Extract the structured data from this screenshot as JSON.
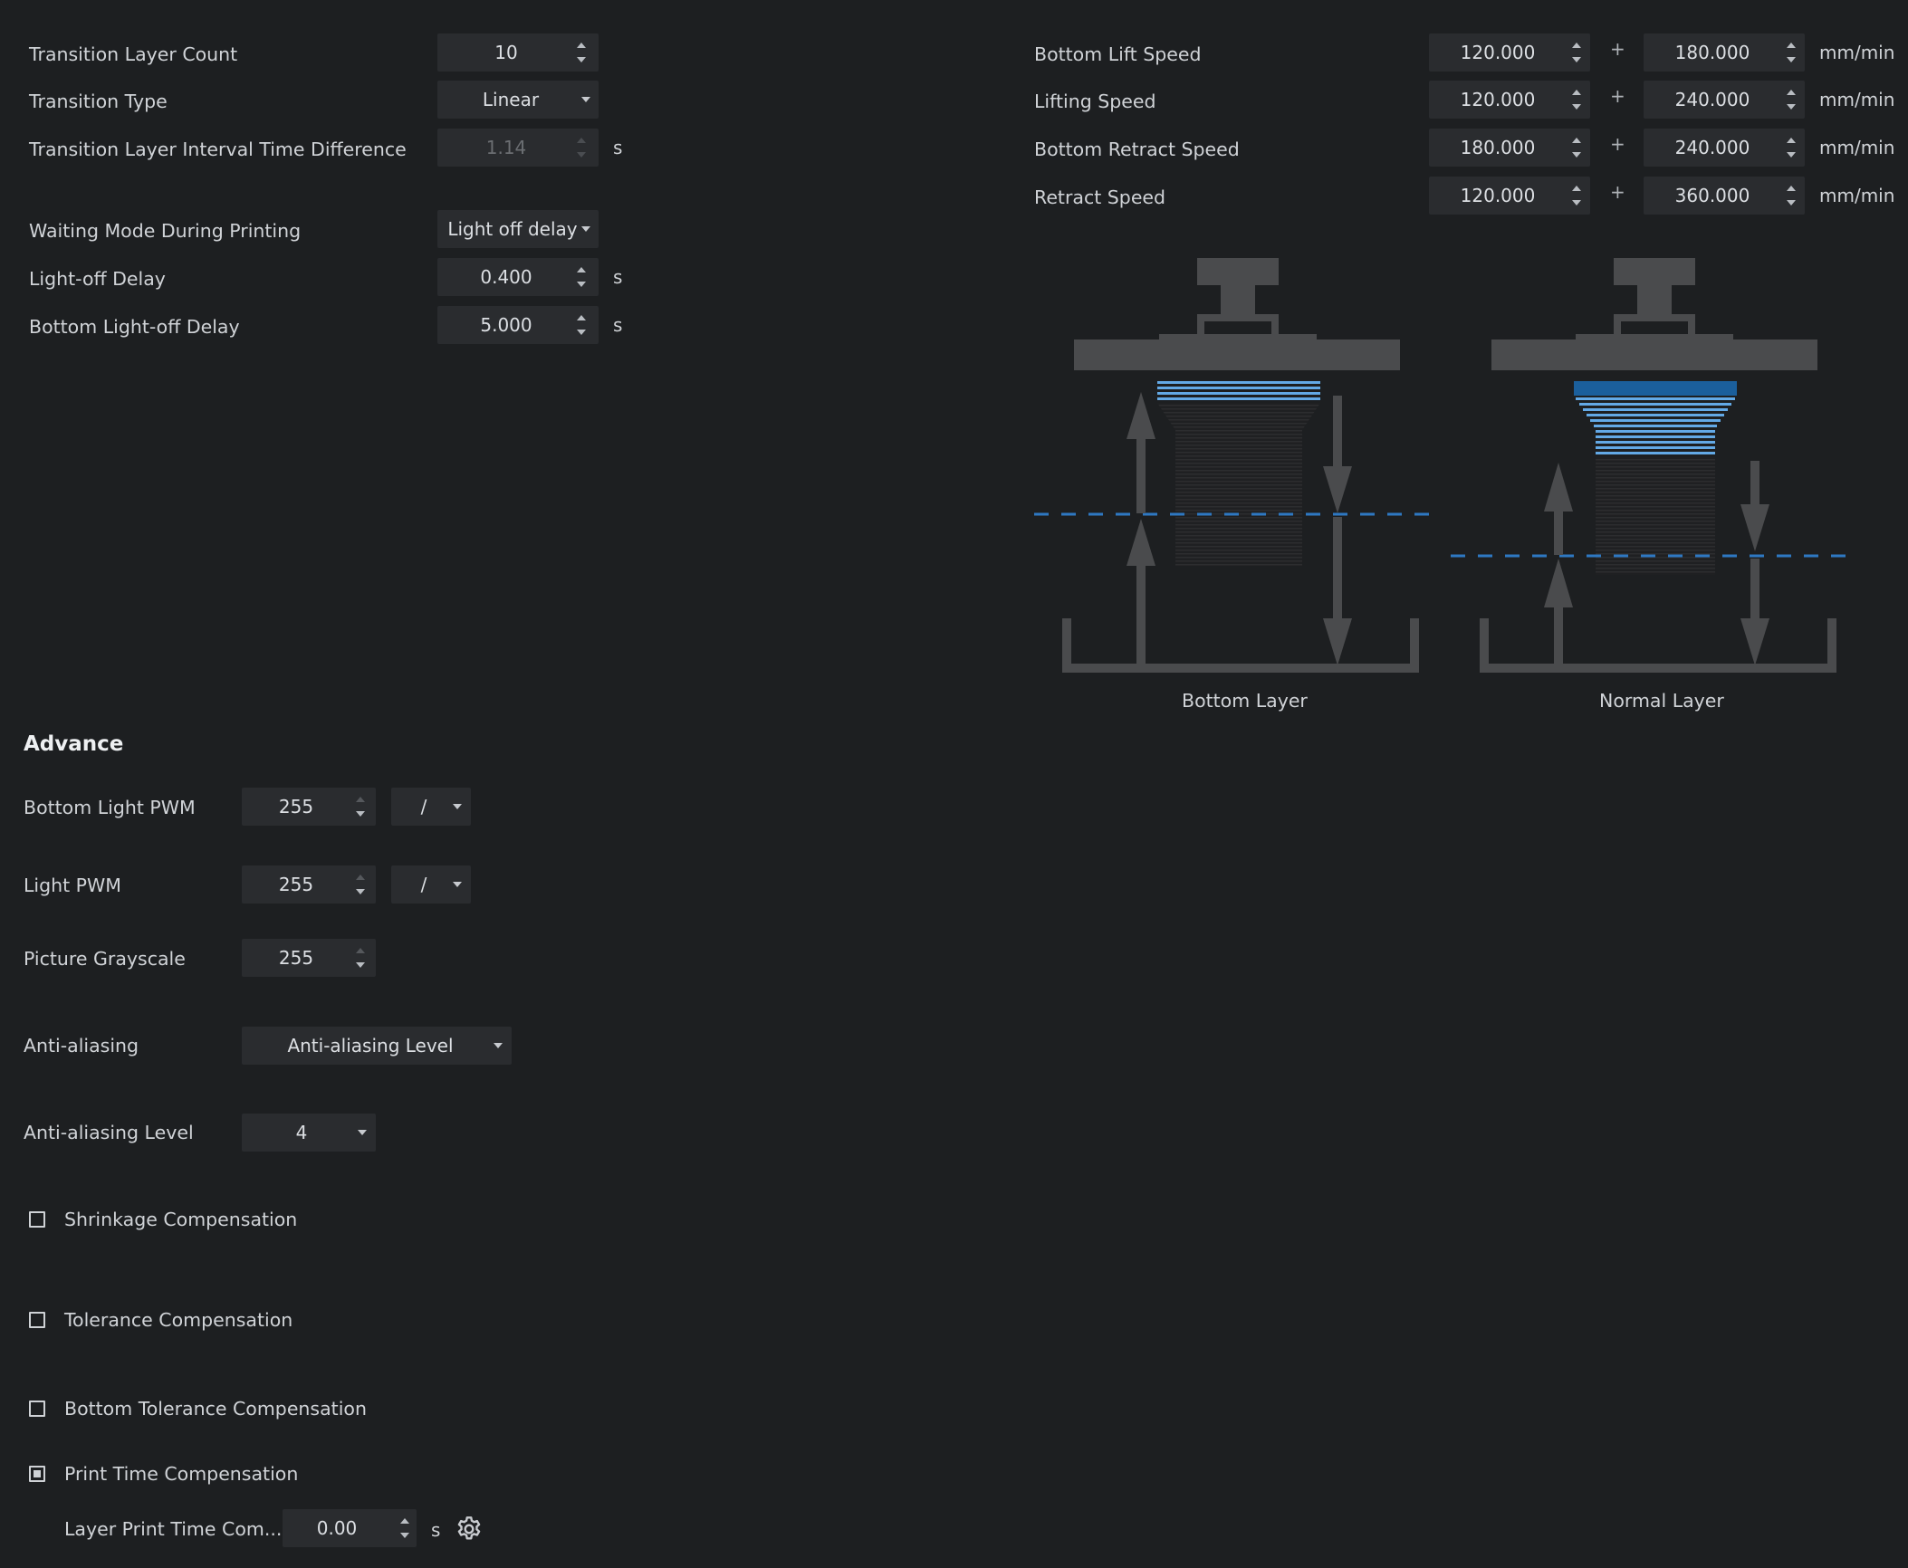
{
  "left_settings": {
    "transition_layer_count": {
      "label": "Transition Layer Count",
      "value": "10"
    },
    "transition_type": {
      "label": "Transition Type",
      "value": "Linear"
    },
    "transition_interval": {
      "label": "Transition Layer Interval Time Difference",
      "value": "1.14",
      "unit": "s"
    },
    "waiting_mode": {
      "label": "Waiting Mode During Printing",
      "value": "Light off delay"
    },
    "light_off_delay": {
      "label": "Light-off Delay",
      "value": "0.400",
      "unit": "s"
    },
    "bottom_light_off_delay": {
      "label": "Bottom Light-off Delay",
      "value": "5.000",
      "unit": "s"
    }
  },
  "speeds": {
    "rows": [
      {
        "label": "Bottom Lift Speed",
        "value1": "120.000",
        "value2": "180.000",
        "unit": "mm/min"
      },
      {
        "label": "Lifting Speed",
        "value1": "120.000",
        "value2": "240.000",
        "unit": "mm/min"
      },
      {
        "label": "Bottom Retract Speed",
        "value1": "180.000",
        "value2": "240.000",
        "unit": "mm/min"
      },
      {
        "label": "Retract Speed",
        "value1": "120.000",
        "value2": "360.000",
        "unit": "mm/min"
      }
    ],
    "plus": "+"
  },
  "diagram": {
    "bottom_caption": "Bottom Layer",
    "normal_caption": "Normal Layer",
    "colors": {
      "platform": "#4a4b4d",
      "layer_blue": "#63a9e6",
      "dash": "#2e78c2"
    }
  },
  "advance": {
    "title": "Advance",
    "bottom_light_pwm": {
      "label": "Bottom Light PWM",
      "value": "255",
      "select": "/"
    },
    "light_pwm": {
      "label": "Light PWM",
      "value": "255",
      "select": "/"
    },
    "picture_grayscale": {
      "label": "Picture Grayscale",
      "value": "255"
    },
    "anti_aliasing": {
      "label": "Anti-aliasing",
      "value": "Anti-aliasing Level"
    },
    "anti_aliasing_level": {
      "label": "Anti-aliasing Level",
      "value": "4"
    },
    "shrinkage": {
      "label": "Shrinkage Compensation",
      "checked": false
    },
    "tolerance": {
      "label": "Tolerance Compensation",
      "checked": false
    },
    "bottom_tolerance": {
      "label": "Bottom Tolerance Compensation",
      "checked": false
    },
    "print_time": {
      "label": "Print Time Compensation",
      "checked": true
    },
    "layer_print_time": {
      "label": "Layer Print Time Com...",
      "value": "0.00",
      "unit": "s",
      "icon": "gear-icon"
    }
  }
}
